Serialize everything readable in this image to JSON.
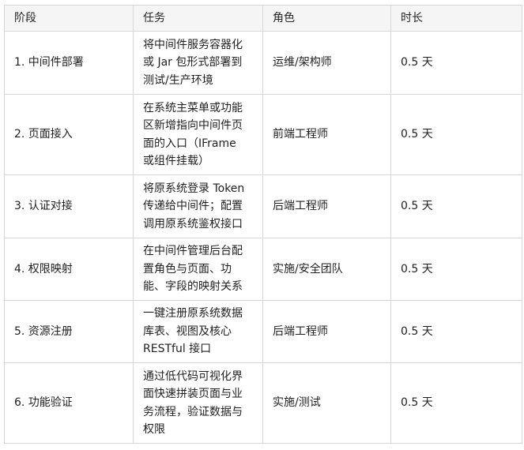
{
  "table": {
    "headers": [
      "阶段",
      "任务",
      "角色",
      "时长"
    ],
    "rows": [
      {
        "stage": "1. 中间件部署",
        "task": "将中间件服务容器化\n或 Jar 包形式部署到\n测试/生产环境",
        "role": "运维/架构师",
        "duration": "0.5 天"
      },
      {
        "stage": "2. 页面接入",
        "task": "在系统主菜单或功能\n区新增指向中间件页\n面的入口（IFrame\n或组件挂载）",
        "role": "前端工程师",
        "duration": "0.5 天"
      },
      {
        "stage": "3. 认证对接",
        "task": "将原系统登录 Token\n传递给中间件；配置\n调用原系统鉴权接口",
        "role": "后端工程师",
        "duration": "0.5 天"
      },
      {
        "stage": "4. 权限映射",
        "task": "在中间件管理后台配\n置角色与页面、功\n能、字段的映射关系",
        "role": "实施/安全团队",
        "duration": "0.5 天"
      },
      {
        "stage": "5. 资源注册",
        "task": "一键注册原系统数据\n库表、视图及核心\nRESTful 接口",
        "role": "后端工程师",
        "duration": "0.5 天"
      },
      {
        "stage": "6. 功能验证",
        "task": "通过低代码可视化界\n面快速拼装页面与业\n务流程，验证数据与\n权限",
        "role": "实施/测试",
        "duration": "0.5 天"
      }
    ]
  }
}
